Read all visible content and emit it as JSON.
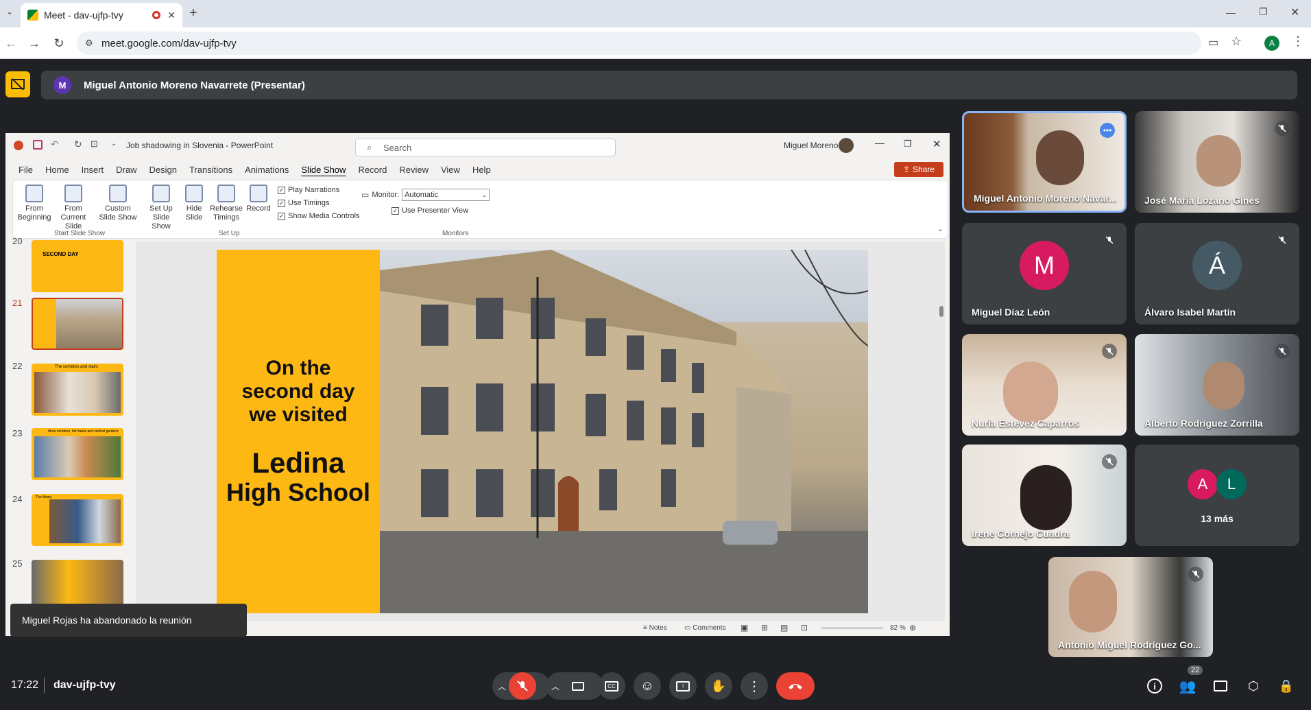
{
  "browser": {
    "tab_title": "Meet - dav-ujfp-tvy",
    "url": "meet.google.com/dav-ujfp-tvy",
    "profile_initial": "A"
  },
  "meet": {
    "presenter_initial": "M",
    "presenter_banner": "Miguel Antonio Moreno Navarrete (Presentar)",
    "time": "17:22",
    "meeting_code": "dav-ujfp-tvy",
    "participant_count": "22",
    "toast": "Miguel Rojas ha abandonado la reunión",
    "participants": [
      {
        "name": "Miguel Antonio Moreno Navar...",
        "type": "video"
      },
      {
        "name": "José María Lozano Gines",
        "type": "video"
      },
      {
        "name": "Miguel Díaz León",
        "type": "avatar",
        "initial": "M",
        "color": "#d81b60"
      },
      {
        "name": "Álvaro Isabel Martín",
        "type": "avatar",
        "initial": "Á",
        "color": "#455a64"
      },
      {
        "name": "Nuria Estevez Caparros",
        "type": "video"
      },
      {
        "name": "Alberto Rodríguez Zorrilla",
        "type": "video"
      },
      {
        "name": "Irene Cornejo Cuadra",
        "type": "video"
      },
      {
        "name": "Antonio Miguel Rodríguez Go...",
        "type": "video"
      }
    ],
    "more": {
      "initial_a": "A",
      "initial_l": "L",
      "label": "13 más"
    }
  },
  "ppt": {
    "title": "Job shadowing in Slovenia - PowerPoint",
    "search_placeholder": "Search",
    "user": "Miguel Moreno",
    "share": "Share",
    "menu": [
      "File",
      "Home",
      "Insert",
      "Draw",
      "Design",
      "Transitions",
      "Animations",
      "Slide Show",
      "Record",
      "Review",
      "View",
      "Help"
    ],
    "ribbon": {
      "from_beginning": "From Beginning",
      "from_current": "From Current Slide",
      "custom_show": "Custom Slide Show",
      "setup_show": "Set Up Slide Show",
      "hide_slide": "Hide Slide",
      "rehearse": "Rehearse Timings",
      "record": "Record",
      "play_narrations": "Play Narrations",
      "use_timings": "Use Timings",
      "show_media": "Show Media Controls",
      "monitor_label": "Monitor:",
      "monitor_value": "Automatic",
      "presenter_view": "Use Presenter View",
      "group_start": "Start Slide Show",
      "group_setup": "Set Up",
      "group_monitors": "Monitors"
    },
    "thumbs": [
      "20",
      "21",
      "22",
      "23",
      "24",
      "25"
    ],
    "thumb_texts": {
      "t20": "SECOND DAY",
      "t22": "The corridors and stairs",
      "t23": "More corridors, fish tanks and vertical gardens",
      "t24": "The library"
    },
    "slide": {
      "line1": "On the",
      "line2": "second day",
      "line3": "we visited",
      "school1": "Ledina",
      "school2": "High School"
    },
    "status": {
      "notes": "Notes",
      "comments": "Comments",
      "zoom": "82 %"
    }
  }
}
